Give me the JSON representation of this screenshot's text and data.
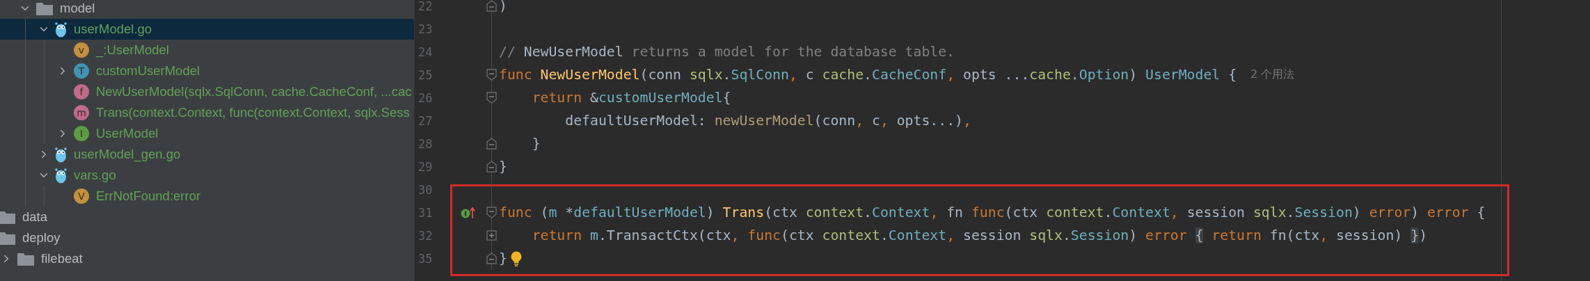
{
  "project_tree": {
    "subtree": [
      {
        "label": "model",
        "kind": "folder",
        "expanded": true,
        "selected": false,
        "modified": false,
        "children": [
          {
            "label": "userModel.go",
            "kind": "gofile",
            "expanded": true,
            "selected": true,
            "modified": true,
            "children": [
              {
                "label": "_:UserModel",
                "kind": "symbol",
                "badge": "v",
                "color": "#c48f3f",
                "selected": false,
                "modified": true
              },
              {
                "label": "customUserModel",
                "kind": "symbol",
                "badge": "T",
                "color": "#3f93b3",
                "expanded": false,
                "selected": false,
                "modified": true
              },
              {
                "label": "NewUserModel(sqlx.SqlConn, cache.CacheConf, ...cac",
                "kind": "symbol",
                "badge": "f",
                "color": "#c06b8b",
                "selected": false,
                "modified": true
              },
              {
                "label": "Trans(context.Context, func(context.Context, sqlx.Sess",
                "kind": "symbol",
                "badge": "m",
                "color": "#c06b8c",
                "selected": false,
                "modified": true
              },
              {
                "label": "UserModel",
                "kind": "symbol",
                "badge": "I",
                "color": "#5d9c43",
                "expanded": false,
                "selected": false,
                "modified": true
              }
            ]
          },
          {
            "label": "userModel_gen.go",
            "kind": "gofile",
            "expanded": false,
            "selected": false,
            "modified": true
          },
          {
            "label": "vars.go",
            "kind": "gofile",
            "expanded": true,
            "selected": false,
            "modified": true,
            "children": [
              {
                "label": "ErrNotFound:error",
                "kind": "symbol",
                "badge": "V",
                "color": "#c48f3e",
                "selected": false,
                "modified": true
              }
            ]
          }
        ]
      }
    ],
    "outer": [
      {
        "label": "data",
        "kind": "folder",
        "selected": false,
        "modified": false
      },
      {
        "label": "deploy",
        "kind": "folder",
        "selected": false,
        "modified": false,
        "children": [
          {
            "label": "filebeat",
            "kind": "folder",
            "expanded": false,
            "selected": false,
            "modified": false
          }
        ]
      }
    ]
  },
  "editor": {
    "lines": [
      {
        "number": "22",
        "fold_marker": {
          "kind": "end"
        },
        "in_frame": false,
        "tokens": [
          {
            "kind": "plain",
            "text": ")"
          }
        ]
      },
      {
        "number": "23",
        "in_frame": false
      },
      {
        "number": "24",
        "in_frame": false,
        "tokens": [
          {
            "kind": "comment",
            "text": "// "
          },
          {
            "kind": "comment-ref",
            "text": "NewUserModel"
          },
          {
            "kind": "comment",
            "text": " returns a model for the database table."
          }
        ]
      },
      {
        "number": "25",
        "fold_marker": {
          "kind": "start"
        },
        "in_frame": false,
        "hint": "2 个用法",
        "tokens": [
          {
            "kind": "keyword",
            "text": "func "
          },
          {
            "kind": "fn",
            "text": "NewUserModel"
          },
          {
            "kind": "plain",
            "text": "(conn "
          },
          {
            "kind": "pkg",
            "text": "sqlx"
          },
          {
            "kind": "plain",
            "text": "."
          },
          {
            "kind": "type",
            "text": "SqlConn"
          },
          {
            "kind": "comma",
            "text": ","
          },
          {
            "kind": "plain",
            "text": " c "
          },
          {
            "kind": "pkg",
            "text": "cache"
          },
          {
            "kind": "plain",
            "text": "."
          },
          {
            "kind": "type",
            "text": "CacheConf"
          },
          {
            "kind": "comma",
            "text": ","
          },
          {
            "kind": "plain",
            "text": " opts ..."
          },
          {
            "kind": "pkg",
            "text": "cache"
          },
          {
            "kind": "plain",
            "text": "."
          },
          {
            "kind": "type",
            "text": "Option"
          },
          {
            "kind": "plain",
            "text": ") "
          },
          {
            "kind": "type",
            "text": "UserModel"
          },
          {
            "kind": "plain",
            "text": " {"
          }
        ]
      },
      {
        "number": "26",
        "fold_marker": {
          "kind": "start"
        },
        "in_frame": false,
        "tokens": [
          {
            "kind": "keyword",
            "text": "    return"
          },
          {
            "kind": "plain",
            "text": " &"
          },
          {
            "kind": "type",
            "text": "customUserModel"
          },
          {
            "kind": "plain",
            "text": "{"
          }
        ]
      },
      {
        "number": "27",
        "in_frame": false,
        "tokens": [
          {
            "kind": "plain",
            "text": "        defaultUserModel: "
          },
          {
            "kind": "call",
            "text": "newUserModel"
          },
          {
            "kind": "plain",
            "text": "(conn"
          },
          {
            "kind": "comma",
            "text": ","
          },
          {
            "kind": "plain",
            "text": " c"
          },
          {
            "kind": "comma",
            "text": ","
          },
          {
            "kind": "plain",
            "text": " opts...)"
          },
          {
            "kind": "comma",
            "text": ","
          }
        ]
      },
      {
        "number": "28",
        "fold_marker": {
          "kind": "end"
        },
        "in_frame": false,
        "tokens": [
          {
            "kind": "plain",
            "text": "    }"
          }
        ]
      },
      {
        "number": "29",
        "fold_marker": {
          "kind": "end"
        },
        "in_frame": false,
        "tokens": [
          {
            "kind": "plain",
            "text": "}"
          }
        ]
      },
      {
        "number": "30",
        "in_frame": true
      },
      {
        "number": "31",
        "fold_marker": {
          "kind": "start"
        },
        "gutter_icon": {
          "kind": "implements"
        },
        "in_frame": true,
        "tokens": [
          {
            "kind": "keyword",
            "text": "func"
          },
          {
            "kind": "plain",
            "text": " ("
          },
          {
            "kind": "receiver",
            "text": "m"
          },
          {
            "kind": "plain",
            "text": " *"
          },
          {
            "kind": "type",
            "text": "defaultUserModel"
          },
          {
            "kind": "plain",
            "text": ") "
          },
          {
            "kind": "fn",
            "text": "Trans"
          },
          {
            "kind": "plain",
            "text": "(ctx "
          },
          {
            "kind": "pkg",
            "text": "context"
          },
          {
            "kind": "plain",
            "text": "."
          },
          {
            "kind": "type",
            "text": "Context"
          },
          {
            "kind": "comma",
            "text": ","
          },
          {
            "kind": "plain",
            "text": " fn "
          },
          {
            "kind": "keyword",
            "text": "func"
          },
          {
            "kind": "plain",
            "text": "(ctx "
          },
          {
            "kind": "pkg",
            "text": "context"
          },
          {
            "kind": "plain",
            "text": "."
          },
          {
            "kind": "type",
            "text": "Context"
          },
          {
            "kind": "comma",
            "text": ","
          },
          {
            "kind": "plain",
            "text": " session "
          },
          {
            "kind": "pkg",
            "text": "sqlx"
          },
          {
            "kind": "plain",
            "text": "."
          },
          {
            "kind": "type",
            "text": "Session"
          },
          {
            "kind": "plain",
            "text": ") "
          },
          {
            "kind": "keyword",
            "text": "error"
          },
          {
            "kind": "plain",
            "text": ") "
          },
          {
            "kind": "keyword",
            "text": "error"
          },
          {
            "kind": "plain",
            "text": " {"
          }
        ]
      },
      {
        "number": "32",
        "fold_marker": {
          "kind": "collapsed"
        },
        "in_frame": true,
        "tokens": [
          {
            "kind": "keyword",
            "text": "    return "
          },
          {
            "kind": "receiver",
            "text": "m"
          },
          {
            "kind": "plain",
            "text": ".TransactCtx(ctx"
          },
          {
            "kind": "comma",
            "text": ", "
          },
          {
            "kind": "keyword",
            "text": "func"
          },
          {
            "kind": "plain",
            "text": "(ctx "
          },
          {
            "kind": "pkg",
            "text": "context"
          },
          {
            "kind": "plain",
            "text": "."
          },
          {
            "kind": "type",
            "text": "Context"
          },
          {
            "kind": "comma",
            "text": ","
          },
          {
            "kind": "plain",
            "text": " session "
          },
          {
            "kind": "pkg",
            "text": "sqlx"
          },
          {
            "kind": "plain",
            "text": "."
          },
          {
            "kind": "type",
            "text": "Session"
          },
          {
            "kind": "plain",
            "text": ") "
          },
          {
            "kind": "keyword",
            "text": "error "
          },
          {
            "kind": "fold-brace",
            "text": "{"
          },
          {
            "kind": "keyword",
            "text": " return"
          },
          {
            "kind": "plain",
            "text": " fn(ctx"
          },
          {
            "kind": "comma",
            "text": ","
          },
          {
            "kind": "plain",
            "text": " session) "
          },
          {
            "kind": "fold-brace",
            "text": "}"
          },
          {
            "kind": "plain",
            "text": ")"
          }
        ]
      },
      {
        "number": "35",
        "fold_marker": {
          "kind": "end"
        },
        "trailing_icon": {
          "kind": "bulb"
        },
        "in_frame": true,
        "tokens": [
          {
            "kind": "plain",
            "text": "}"
          }
        ]
      }
    ]
  }
}
